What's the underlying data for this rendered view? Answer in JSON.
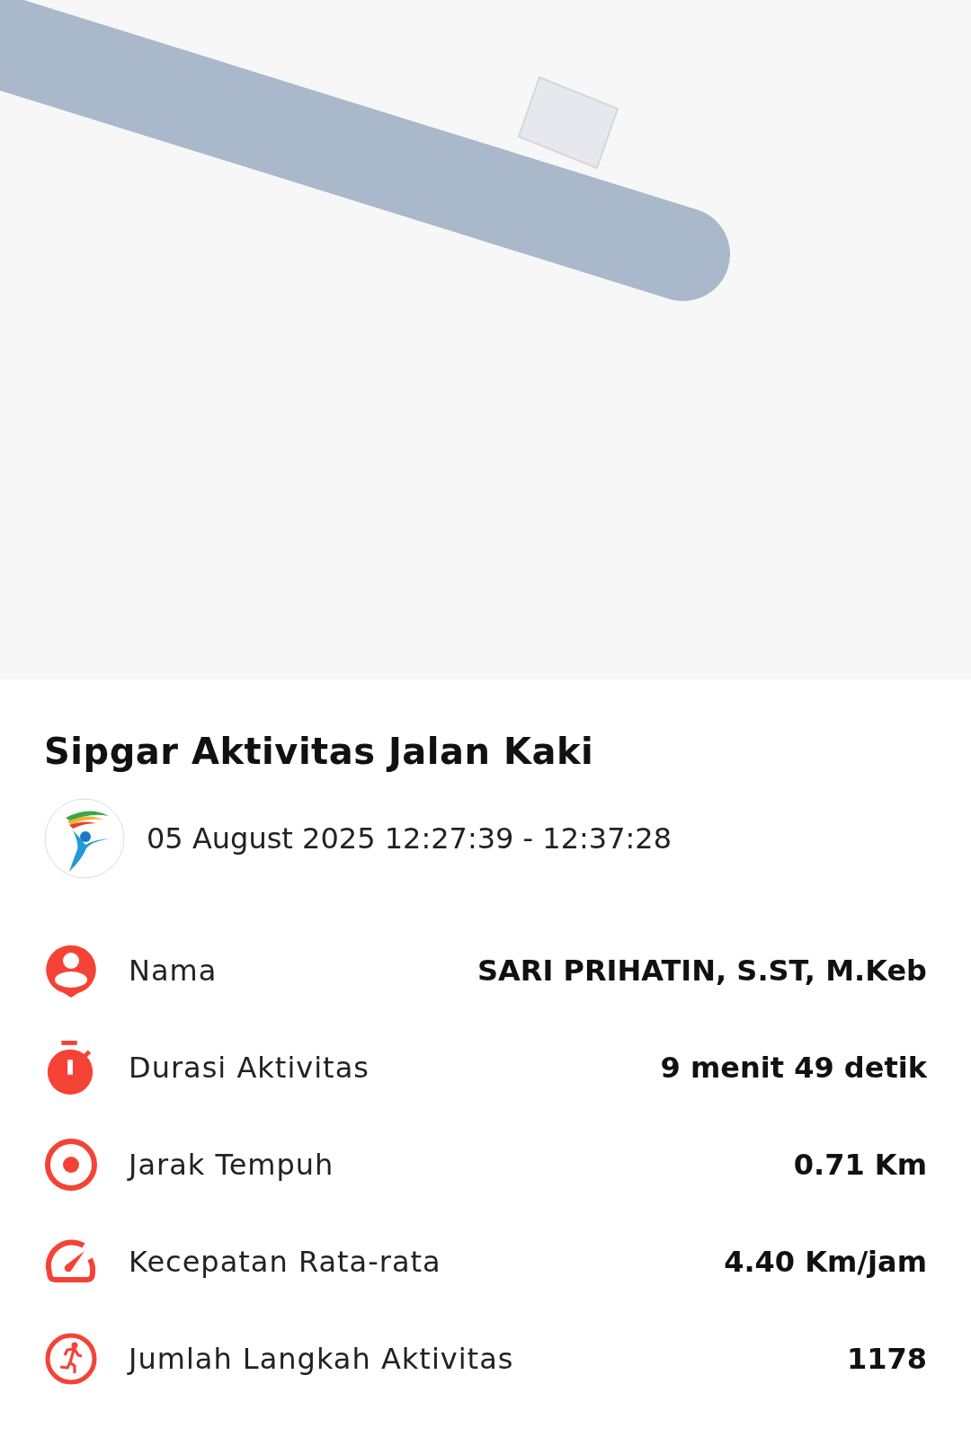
{
  "title": "Sipgar Aktivitas Jalan Kaki",
  "session": {
    "date_range": "05 August 2025 12:27:39 - 12:37:28"
  },
  "rows": [
    {
      "kind": "person",
      "label": "Nama",
      "value": "SARI PRIHATIN, S.ST, M.Keb"
    },
    {
      "kind": "timer",
      "label": "Durasi Aktivitas",
      "value": "9 menit 49 detik"
    },
    {
      "kind": "target",
      "label": "Jarak Tempuh",
      "value": "0.71 Km"
    },
    {
      "kind": "speed",
      "label": "Kecepatan Rata-rata",
      "value": "4.40 Km/jam"
    },
    {
      "kind": "steps",
      "label": "Jumlah Langkah Aktivitas",
      "value": "1178"
    }
  ]
}
